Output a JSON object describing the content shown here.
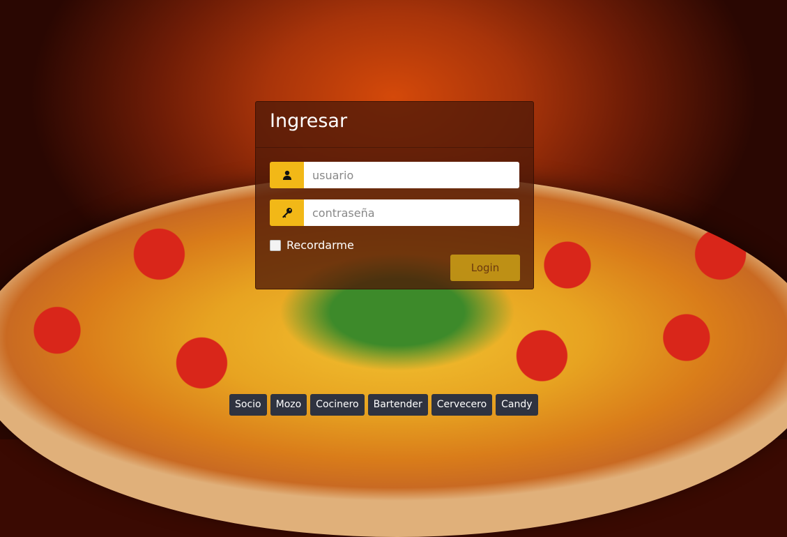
{
  "login": {
    "title": "Ingresar",
    "username_placeholder": "usuario",
    "username_value": "",
    "password_placeholder": "contraseña",
    "password_value": "",
    "remember_label": "Recordarme",
    "remember_checked": false,
    "submit_label": "Login",
    "icons": {
      "username": "user-icon",
      "password": "key-icon"
    },
    "accent_color": "#f2b817"
  },
  "roles": [
    {
      "label": "Socio"
    },
    {
      "label": "Mozo"
    },
    {
      "label": "Cocinero"
    },
    {
      "label": "Bartender"
    },
    {
      "label": "Cervecero"
    },
    {
      "label": "Candy"
    }
  ],
  "background": {
    "description_icon": "pizza-image"
  }
}
